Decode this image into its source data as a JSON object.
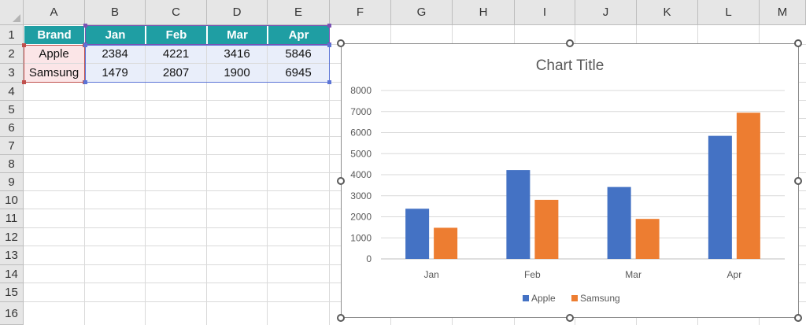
{
  "spreadsheet": {
    "column_headers": [
      "A",
      "B",
      "C",
      "D",
      "E",
      "F",
      "G",
      "H",
      "I",
      "J",
      "K",
      "L",
      "M"
    ],
    "row_headers": [
      "1",
      "2",
      "3",
      "4",
      "5",
      "6",
      "7",
      "8",
      "9",
      "10",
      "11",
      "12",
      "13",
      "14",
      "15",
      "16"
    ],
    "table": {
      "header": [
        "Brand",
        "Jan",
        "Feb",
        "Mar",
        "Apr"
      ],
      "rows": [
        [
          "Apple",
          "2384",
          "4221",
          "3416",
          "5846"
        ],
        [
          "Samsung",
          "1479",
          "2807",
          "1900",
          "6945"
        ]
      ]
    }
  },
  "colors": {
    "header_fill": "#1f9ea3",
    "brand_fill": "#fbe5e7",
    "value_fill": "#e9eefa",
    "apple": "#4472c4",
    "samsung": "#ed7d31"
  },
  "chart_data": {
    "type": "bar",
    "title": "Chart Title",
    "categories": [
      "Jan",
      "Feb",
      "Mar",
      "Apr"
    ],
    "series": [
      {
        "name": "Apple",
        "values": [
          2384,
          4221,
          3416,
          5846
        ],
        "color": "#4472c4"
      },
      {
        "name": "Samsung",
        "values": [
          1479,
          2807,
          1900,
          6945
        ],
        "color": "#ed7d31"
      }
    ],
    "ylim": [
      0,
      8000
    ],
    "yticks": [
      "0",
      "1000",
      "2000",
      "3000",
      "4000",
      "5000",
      "6000",
      "7000",
      "8000"
    ],
    "grid": true,
    "legend": "bottom"
  }
}
